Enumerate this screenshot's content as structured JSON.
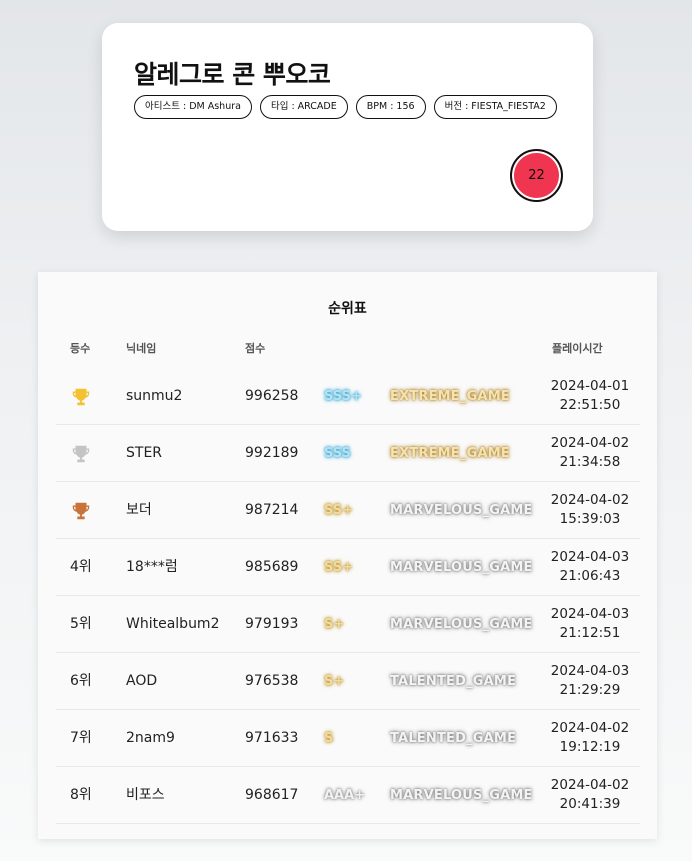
{
  "song": {
    "title": "알레그로 콘 뿌오코",
    "tags": [
      "아티스트 : DM Ashura",
      "타입 : ARCADE",
      "BPM : 156",
      "버전 : FIESTA_FIESTA2"
    ],
    "level": "22",
    "level_color": "#ef3550"
  },
  "ranking": {
    "title": "순위표",
    "headers": {
      "rank": "등수",
      "nickname": "닉네임",
      "score": "점수",
      "playtime": "플레이시간"
    },
    "rows": [
      {
        "rank": "",
        "trophy": "gold-trophy-icon",
        "nickname": "sunmu2",
        "score": "996258",
        "grade": "SSS+",
        "plate": "EXTREME_GAME",
        "date": "2024-04-01",
        "time": "22:51:50"
      },
      {
        "rank": "",
        "trophy": "silver-trophy-icon",
        "nickname": "STER",
        "score": "992189",
        "grade": "SSS",
        "plate": "EXTREME_GAME",
        "date": "2024-04-02",
        "time": "21:34:58"
      },
      {
        "rank": "",
        "trophy": "bronze-trophy-icon",
        "nickname": "보더",
        "score": "987214",
        "grade": "SS+",
        "plate": "MARVELOUS_GAME",
        "date": "2024-04-02",
        "time": "15:39:03"
      },
      {
        "rank": "4위",
        "trophy": "",
        "nickname": "18***럼",
        "score": "985689",
        "grade": "SS+",
        "plate": "MARVELOUS_GAME",
        "date": "2024-04-03",
        "time": "21:06:43"
      },
      {
        "rank": "5위",
        "trophy": "",
        "nickname": "Whitealbum2",
        "score": "979193",
        "grade": "S+",
        "plate": "MARVELOUS_GAME",
        "date": "2024-04-03",
        "time": "21:12:51"
      },
      {
        "rank": "6위",
        "trophy": "",
        "nickname": "AOD",
        "score": "976538",
        "grade": "S+",
        "plate": "TALENTED_GAME",
        "date": "2024-04-03",
        "time": "21:29:29"
      },
      {
        "rank": "7위",
        "trophy": "",
        "nickname": "2nam9",
        "score": "971633",
        "grade": "S",
        "plate": "TALENTED_GAME",
        "date": "2024-04-02",
        "time": "19:12:19"
      },
      {
        "rank": "8위",
        "trophy": "",
        "nickname": "비포스",
        "score": "968617",
        "grade": "AAA+",
        "plate": "MARVELOUS_GAME",
        "date": "2024-04-02",
        "time": "20:41:39"
      }
    ]
  },
  "colors": {
    "trophy_gold": "#f2c230",
    "trophy_silver": "#c4c4c4",
    "trophy_bronze": "#c8733a"
  }
}
